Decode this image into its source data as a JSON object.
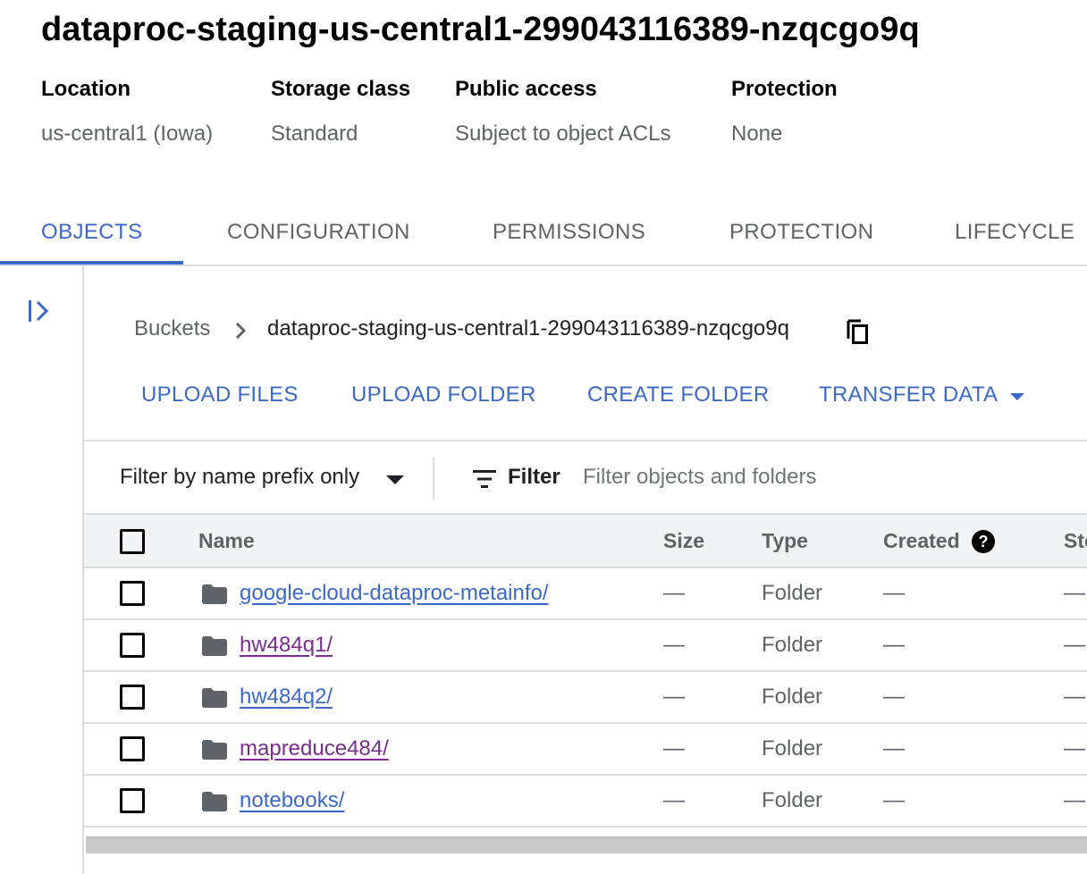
{
  "bucket": {
    "title": "dataproc-staging-us-central1-299043116389-nzqcgo9q",
    "meta": [
      {
        "label": "Location",
        "value": "us-central1 (Iowa)"
      },
      {
        "label": "Storage class",
        "value": "Standard"
      },
      {
        "label": "Public access",
        "value": "Subject to object ACLs"
      },
      {
        "label": "Protection",
        "value": "None"
      }
    ]
  },
  "tabs": [
    {
      "label": "OBJECTS",
      "active": true
    },
    {
      "label": "CONFIGURATION",
      "active": false
    },
    {
      "label": "PERMISSIONS",
      "active": false
    },
    {
      "label": "PROTECTION",
      "active": false
    },
    {
      "label": "LIFECYCLE",
      "active": false
    }
  ],
  "breadcrumb": {
    "root": "Buckets",
    "current": "dataproc-staging-us-central1-299043116389-nzqcgo9q"
  },
  "actions": {
    "upload_files": "UPLOAD FILES",
    "upload_folder": "UPLOAD FOLDER",
    "create_folder": "CREATE FOLDER",
    "transfer_data": "TRANSFER DATA"
  },
  "filter": {
    "mode": "Filter by name prefix only",
    "label": "Filter",
    "placeholder": "Filter objects and folders"
  },
  "table": {
    "columns": [
      "Name",
      "Size",
      "Type",
      "Created",
      "Sto"
    ],
    "rows": [
      {
        "name": "google-cloud-dataproc-metainfo/",
        "size": "—",
        "type": "Folder",
        "created": "—",
        "storage": "—",
        "visited": false
      },
      {
        "name": "hw484q1/",
        "size": "—",
        "type": "Folder",
        "created": "—",
        "storage": "—",
        "visited": true
      },
      {
        "name": "hw484q2/",
        "size": "—",
        "type": "Folder",
        "created": "—",
        "storage": "—",
        "visited": false
      },
      {
        "name": "mapreduce484/",
        "size": "—",
        "type": "Folder",
        "created": "—",
        "storage": "—",
        "visited": true
      },
      {
        "name": "notebooks/",
        "size": "—",
        "type": "Folder",
        "created": "—",
        "storage": "—",
        "visited": false
      }
    ]
  },
  "colors": {
    "accent": "#3c68c8",
    "visited_link": "#7b2d8f",
    "muted_text": "#5f6368",
    "header_bg": "#f1f3f4",
    "divider": "#dadce0"
  }
}
